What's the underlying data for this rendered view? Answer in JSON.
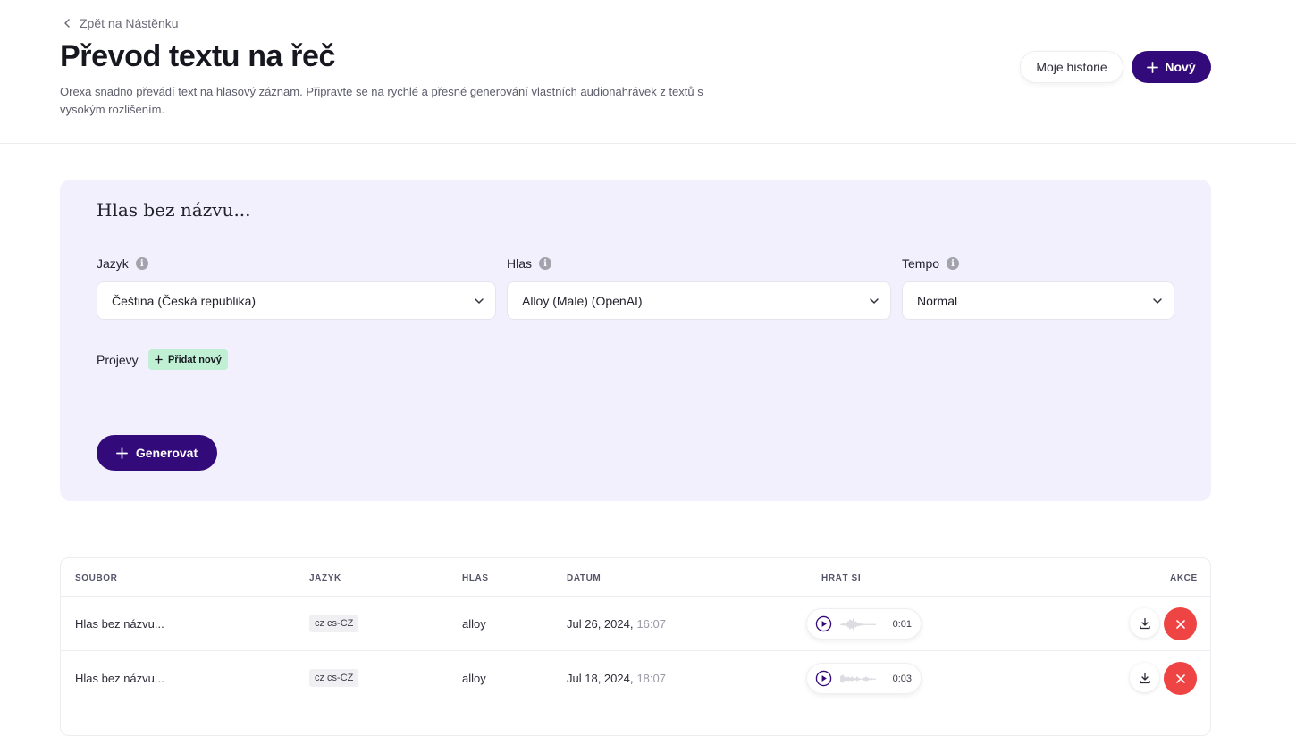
{
  "header": {
    "back_label": "Zpět na Nástěnku",
    "title": "Převod textu na řeč",
    "description": "Orexa snadno převádí text na hlasový záznam. Připravte se na rychlé a přesné generování vlastních audionahrávek z textů s vysokým rozlišením.",
    "history_label": "Moje historie",
    "new_label": "Nový"
  },
  "form": {
    "voice_name": "Hlas bez názvu...",
    "language_label": "Jazyk",
    "language_value": "Čeština (Česká republika)",
    "voice_label": "Hlas",
    "voice_value": "Alloy (Male) (OpenAI)",
    "tempo_label": "Tempo",
    "tempo_value": "Normal",
    "speeches_label": "Projevy",
    "add_new_label": "Přidat nový",
    "generate_label": "Generovat"
  },
  "table": {
    "columns": [
      "SOUBOR",
      "JAZYK",
      "HLAS",
      "DATUM",
      "HRÁT SI",
      "AKCE"
    ],
    "rows": [
      {
        "file": "Hlas bez názvu...",
        "language": "cz cs-CZ",
        "voice": "alloy",
        "date": "Jul 26, 2024,",
        "time": "16:07",
        "duration": "0:01"
      },
      {
        "file": "Hlas bez názvu...",
        "language": "cz cs-CZ",
        "voice": "alloy",
        "date": "Jul 18, 2024,",
        "time": "18:07",
        "duration": "0:03"
      }
    ]
  },
  "colors": {
    "primary": "#330a7a",
    "panel_bg": "#f2f0fd",
    "danger": "#ef4444",
    "success_bg": "#bff0d4"
  }
}
